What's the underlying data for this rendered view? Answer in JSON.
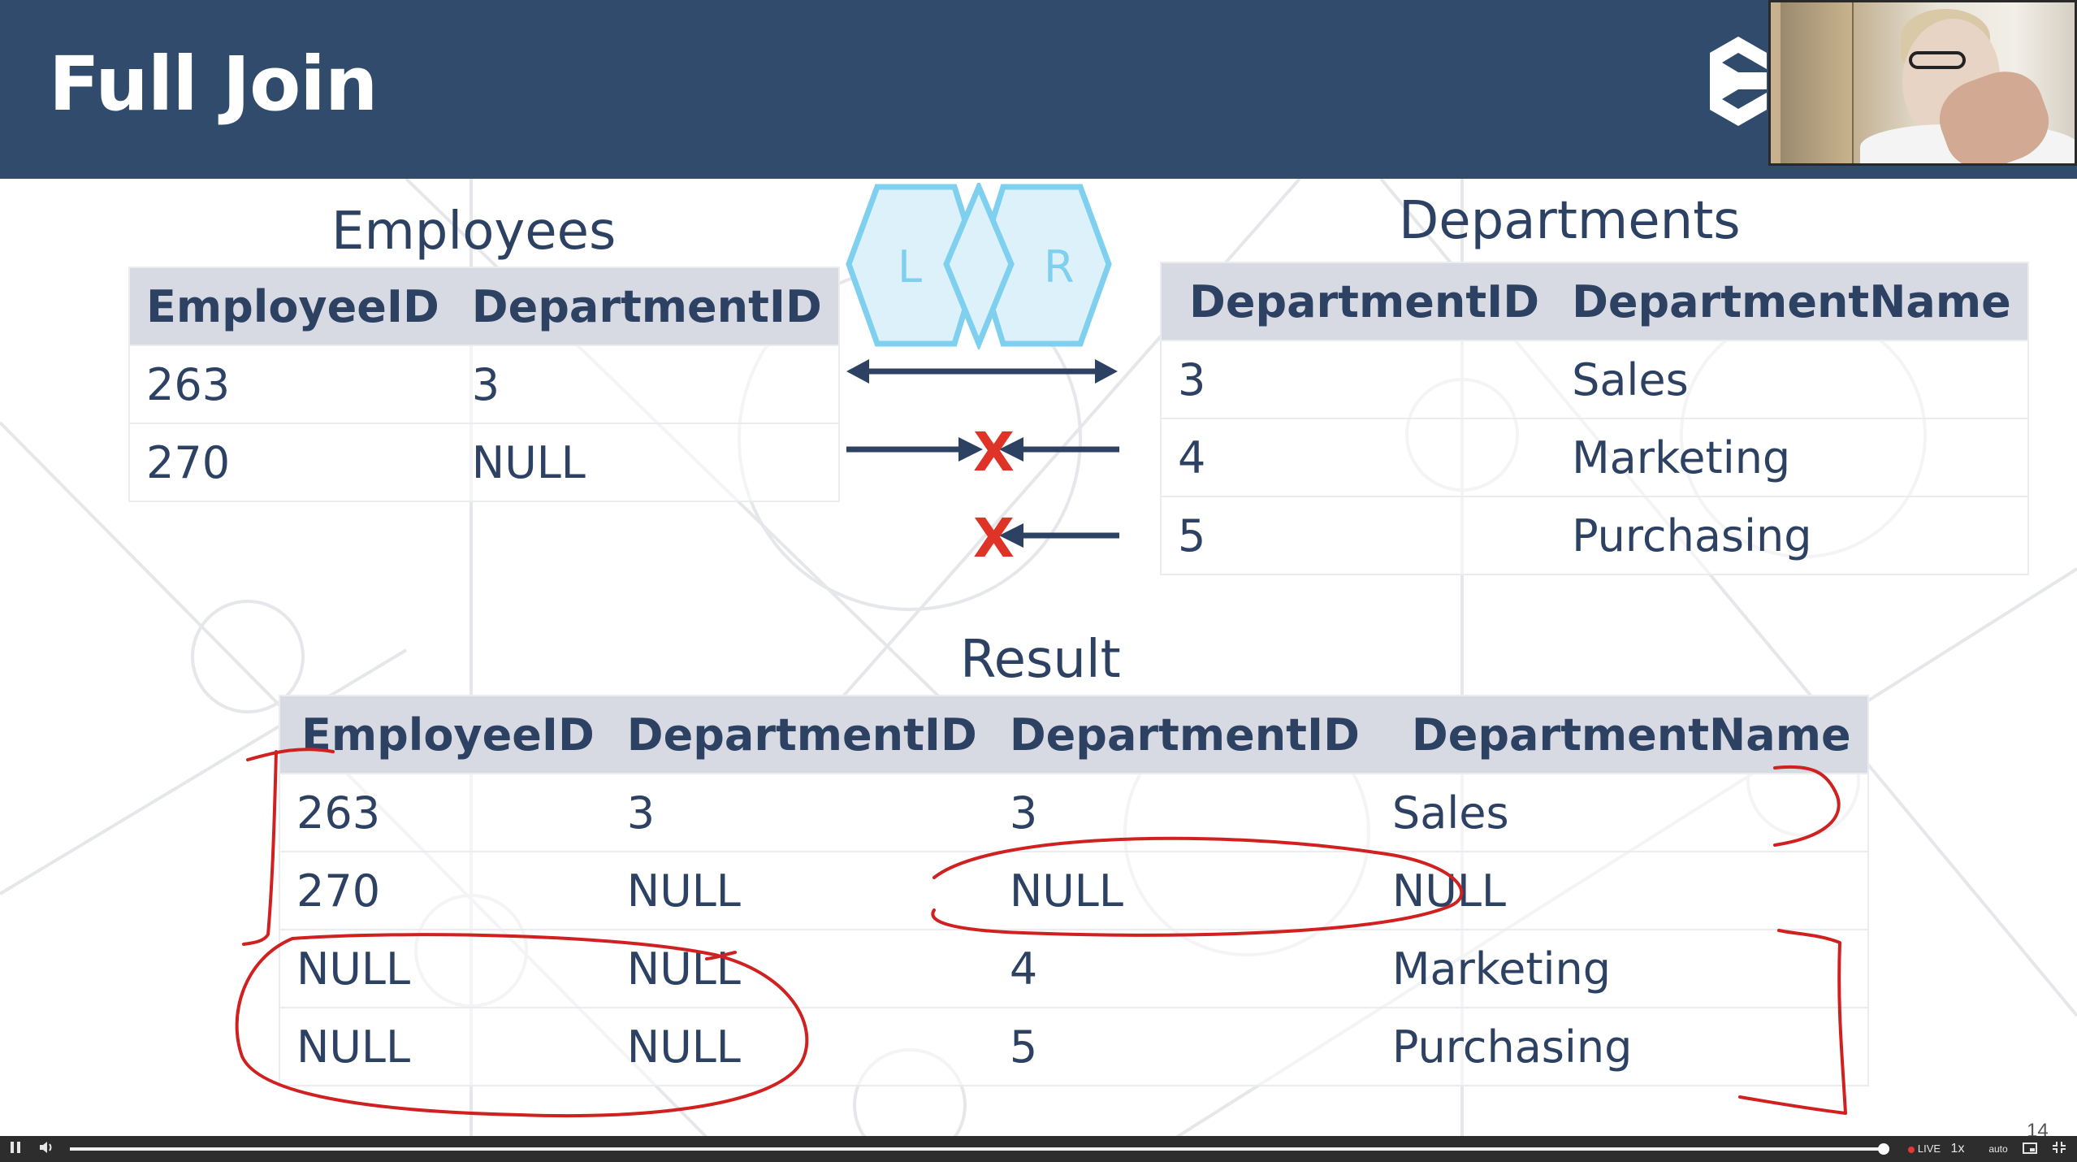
{
  "slide": {
    "title": "Full Join",
    "page_number": "14"
  },
  "employees": {
    "caption": "Employees",
    "columns": [
      "EmployeeID",
      "DepartmentID"
    ],
    "rows": [
      [
        "263",
        "3"
      ],
      [
        "270",
        "NULL"
      ]
    ]
  },
  "departments": {
    "caption": "Departments",
    "columns": [
      "DepartmentID",
      "DepartmentName"
    ],
    "rows": [
      [
        "3",
        "Sales"
      ],
      [
        "4",
        "Marketing"
      ],
      [
        "5",
        "Purchasing"
      ]
    ]
  },
  "venn": {
    "left_label": "L",
    "right_label": "R"
  },
  "arrows": {
    "no_match_mark": "X"
  },
  "result": {
    "caption": "Result",
    "columns": [
      "EmployeeID",
      "DepartmentID",
      "DepartmentID",
      "DepartmentName"
    ],
    "rows": [
      [
        "263",
        "3",
        "3",
        "Sales"
      ],
      [
        "270",
        "NULL",
        "NULL",
        "NULL"
      ],
      [
        "NULL",
        "NULL",
        "4",
        "Marketing"
      ],
      [
        "NULL",
        "NULL",
        "5",
        "Purchasing"
      ]
    ]
  },
  "player": {
    "pause_icon": "pause-icon",
    "volume_icon": "volume-icon",
    "progress": 1.0,
    "live_label": "LIVE",
    "speed_label": "1x",
    "quality_label": "auto",
    "pip_icon": "picture-in-picture-icon",
    "exit_fullscreen_icon": "exit-fullscreen-icon"
  },
  "colors": {
    "header": "#304b6c",
    "text": "#2d4163",
    "table_header": "#d8dae3",
    "venn_fill": "#ddf1fb",
    "venn_stroke": "#7fd0ef",
    "x_mark": "#e03327",
    "annotation_ink": "#d02020"
  }
}
